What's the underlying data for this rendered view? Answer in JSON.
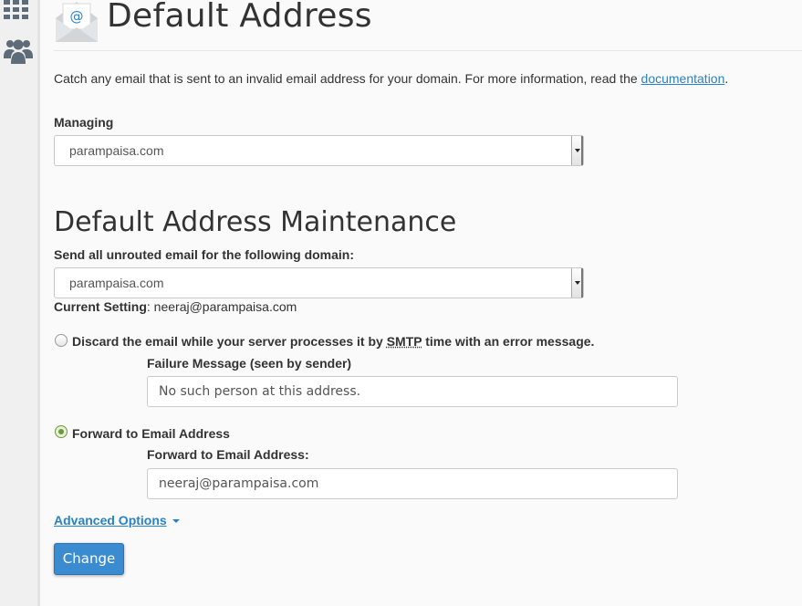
{
  "header": {
    "title": "Default Address"
  },
  "description": {
    "text": "Catch any email that is sent to an invalid email address for your domain. For more information, read the ",
    "link": "documentation",
    "after": "."
  },
  "managing": {
    "label": "Managing",
    "value": "parampaisa.com"
  },
  "maintenance": {
    "title": "Default Address Maintenance",
    "domain_label": "Send all unrouted email for the following domain:",
    "domain_value": "parampaisa.com",
    "current_label": "Current Setting",
    "current_value": ": neeraj@parampaisa.com"
  },
  "discard": {
    "label_pre": "Discard the email while your server processes it by ",
    "label_abbr": "SMTP",
    "label_post": " time with an error message.",
    "failure_label": "Failure Message (seen by sender)",
    "failure_value": "No such person at this address.",
    "selected": false
  },
  "forward": {
    "label": "Forward to Email Address",
    "field_label": "Forward to Email Address:",
    "field_value": "neeraj@parampaisa.com",
    "selected": true
  },
  "advanced": {
    "label": "Advanced Options"
  },
  "submit": {
    "label": "Change"
  },
  "sidebar": {
    "icons": [
      "grid-icon",
      "users-icon"
    ]
  },
  "colors": {
    "link": "#2a82c4",
    "button": "#3a8bd0",
    "radio_checked": "#6a9a3a"
  }
}
